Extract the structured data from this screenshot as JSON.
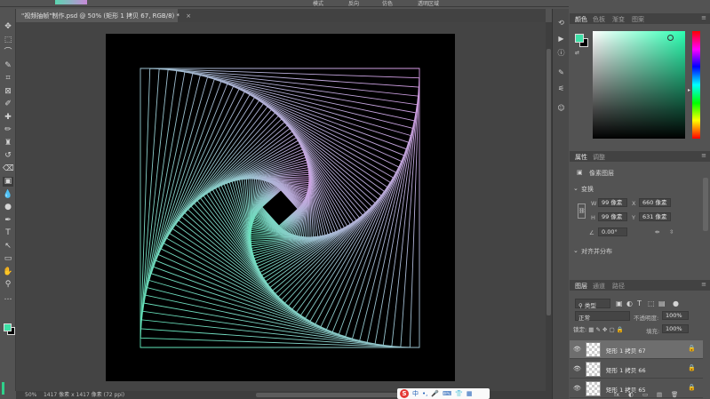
{
  "options_bar": {
    "items": [
      "模式",
      "反向",
      "仿色",
      "透明区域"
    ]
  },
  "document": {
    "tab_title": "\"视频抽帧\"制作.psd @ 50% (矩形 1 拷贝 67, RGB/8) *",
    "close_glyph": "×"
  },
  "status_bar": {
    "zoom": "50%",
    "doc_info": "1417 像素 x 1417 像素 (72 ppi)"
  },
  "ime": {
    "logo": "S",
    "items": [
      "中",
      "•,",
      "🎤",
      "⌨",
      "👕",
      "▦"
    ]
  },
  "tools": [
    {
      "icon": "move-icon",
      "glyph": "✥"
    },
    {
      "icon": "marquee-icon",
      "glyph": "⬚"
    },
    {
      "icon": "lasso-icon",
      "glyph": "⌒"
    },
    {
      "icon": "quick-select-icon",
      "glyph": "✎"
    },
    {
      "icon": "crop-icon",
      "glyph": "⌗"
    },
    {
      "icon": "frame-icon",
      "glyph": "⊠"
    },
    {
      "icon": "eyedropper-icon",
      "glyph": "✐"
    },
    {
      "icon": "healing-icon",
      "glyph": "✚"
    },
    {
      "icon": "brush-icon",
      "glyph": "✏"
    },
    {
      "icon": "stamp-icon",
      "glyph": "♜"
    },
    {
      "icon": "history-brush-icon",
      "glyph": "↺"
    },
    {
      "icon": "eraser-icon",
      "glyph": "⌫"
    },
    {
      "icon": "gradient-icon",
      "glyph": "▣"
    },
    {
      "icon": "blur-icon",
      "glyph": "💧"
    },
    {
      "icon": "dodge-icon",
      "glyph": "●"
    },
    {
      "icon": "pen-icon",
      "glyph": "✒"
    },
    {
      "icon": "type-icon",
      "glyph": "T"
    },
    {
      "icon": "path-select-icon",
      "glyph": "↖"
    },
    {
      "icon": "shape-icon",
      "glyph": "▭"
    },
    {
      "icon": "hand-icon",
      "glyph": "✋"
    },
    {
      "icon": "zoom-icon",
      "glyph": "⚲"
    },
    {
      "icon": "more-tools-icon",
      "glyph": "…"
    }
  ],
  "panel_strip": [
    {
      "icon": "history-icon",
      "glyph": "⟲"
    },
    {
      "icon": "play-icon",
      "glyph": "▶"
    },
    {
      "icon": "info-icon",
      "glyph": "ⓘ"
    },
    {
      "icon": "brush-settings-icon",
      "glyph": "✎"
    },
    {
      "icon": "adjust-icon",
      "glyph": "⚟"
    },
    {
      "icon": "alien-icon",
      "glyph": "☺"
    }
  ],
  "color_panel": {
    "tabs": [
      "颜色",
      "色板",
      "渐变",
      "图案"
    ],
    "foreground": "#3de0a6",
    "background": "#000000"
  },
  "properties_panel": {
    "tabs": [
      "属性",
      "调整"
    ],
    "type_label": "像素图层",
    "transform_label": "变换",
    "w_label": "W",
    "w_value": "99 像素",
    "x_label": "X",
    "x_value": "660 像素",
    "h_label": "H",
    "h_value": "99 像素",
    "y_label": "Y",
    "y_value": "631 像素",
    "angle_value": "0.00°",
    "align_label": "对齐并分布"
  },
  "layers_panel": {
    "tabs": [
      "图层",
      "通道",
      "路径"
    ],
    "filter": "类型",
    "blend_mode": "正常",
    "opacity_label": "不透明度:",
    "opacity_value": "100%",
    "lock_label": "锁定:",
    "fill_label": "填充:",
    "fill_value": "100%",
    "layers": [
      {
        "name": "矩形 1 拷贝 67",
        "selected": true
      },
      {
        "name": "矩形 1 拷贝 66",
        "selected": false
      },
      {
        "name": "矩形 1 拷贝 65",
        "selected": false
      }
    ],
    "bottom_icons": [
      "fx",
      "◐",
      "▭",
      "▤",
      "🗑"
    ]
  },
  "colors": {
    "artwork_start": "#5ee8b8",
    "artwork_end": "#d89ae6"
  }
}
